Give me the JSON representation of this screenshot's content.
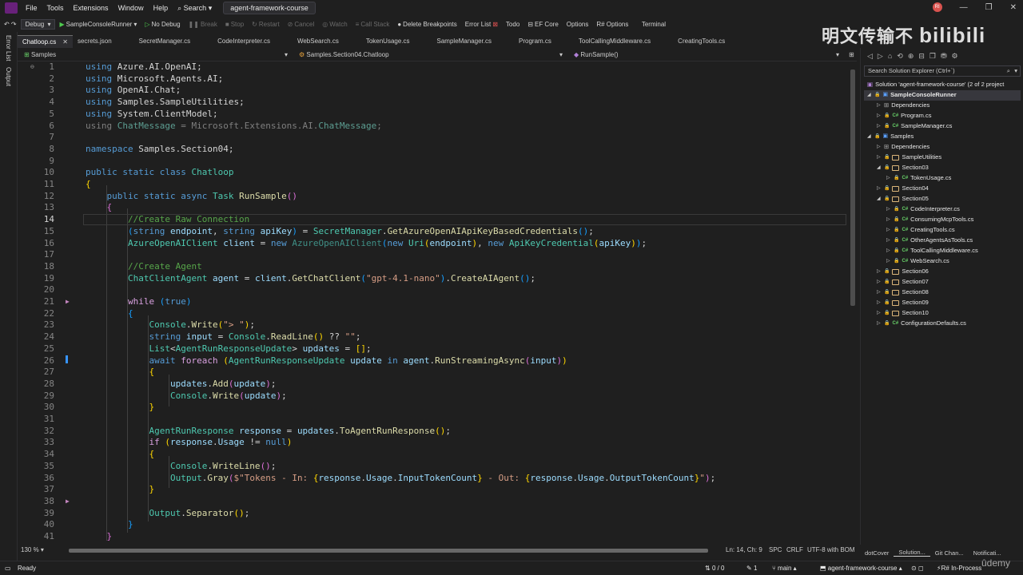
{
  "menu": {
    "items": [
      "File",
      "Tools",
      "Extensions",
      "Window",
      "Help"
    ],
    "search": "Search",
    "project": "agent-framework-course"
  },
  "toolbar": {
    "config": "Debug",
    "run_target": "SampleConsoleRunner",
    "no_debug": "No Debug",
    "break": "Break",
    "stop": "Stop",
    "restart": "Restart",
    "cancel": "Cancel",
    "watch": "Watch",
    "call_stack": "Call Stack",
    "delete_breakpoints": "Delete Breakpoints",
    "error_list": "Error List",
    "todo": "Todo",
    "ef_core": "EF Core",
    "options": "Options",
    "r_options": "R# Options",
    "terminal": "Terminal"
  },
  "left_strip": {
    "error_list": "Error List",
    "output": "Output"
  },
  "tabs": [
    "Chatloop.cs",
    "secrets.json",
    "SecretManager.cs",
    "CodeInterpreter.cs",
    "WebSearch.cs",
    "TokenUsage.cs",
    "SampleManager.cs",
    "Program.cs",
    "ToolCallingMiddleware.cs",
    "CreatingTools.cs"
  ],
  "nav": {
    "project": "Samples",
    "class": "Samples.Section04.Chatloop",
    "method": "RunSample()"
  },
  "editor": {
    "zoom": "130 %",
    "position": "Ln: 14, Ch: 9",
    "indent": "SPC",
    "line_ending": "CRLF",
    "encoding": "UTF-8 with BOM",
    "line_numbers": [
      "1",
      "2",
      "3",
      "4",
      "5",
      "6",
      "7",
      "8",
      "9",
      "10",
      "11",
      "12",
      "13",
      "14",
      "15",
      "16",
      "17",
      "18",
      "19",
      "20",
      "21",
      "22",
      "23",
      "24",
      "25",
      "26",
      "27",
      "28",
      "29",
      "30",
      "31",
      "32",
      "33",
      "34",
      "35",
      "36",
      "37",
      "38",
      "39",
      "40",
      "41"
    ]
  },
  "solution_explorer": {
    "search_placeholder": "Search Solution Explorer (Ctrl+`)",
    "solution": "Solution 'agent-framework-course' (2 of 2 project",
    "items": [
      "SampleConsoleRunner",
      "Dependencies",
      "Program.cs",
      "SampleManager.cs",
      "Samples",
      "Dependencies",
      "SampleUtilities",
      "Section03",
      "TokenUsage.cs",
      "Section04",
      "Section05",
      "CodeInterpreter.cs",
      "ConsumingMcpTools.cs",
      "CreatingTools.cs",
      "OtherAgentsAsTools.cs",
      "ToolCallingMiddleware.cs",
      "WebSearch.cs",
      "Section06",
      "Section07",
      "Section08",
      "Section09",
      "Section10",
      "ConfigurationDefaults.cs"
    ],
    "bottom_tabs": [
      "dotCover",
      "Solution...",
      "Git Chan...",
      "Notificati..."
    ]
  },
  "status": {
    "ready": "Ready",
    "errors": "0 / 0",
    "pencil_count": "1",
    "branch": "main",
    "repo": "agent-framework-course",
    "resharper": "R# In-Process"
  },
  "watermark": "明文传输不",
  "udemy": "ûdemy"
}
